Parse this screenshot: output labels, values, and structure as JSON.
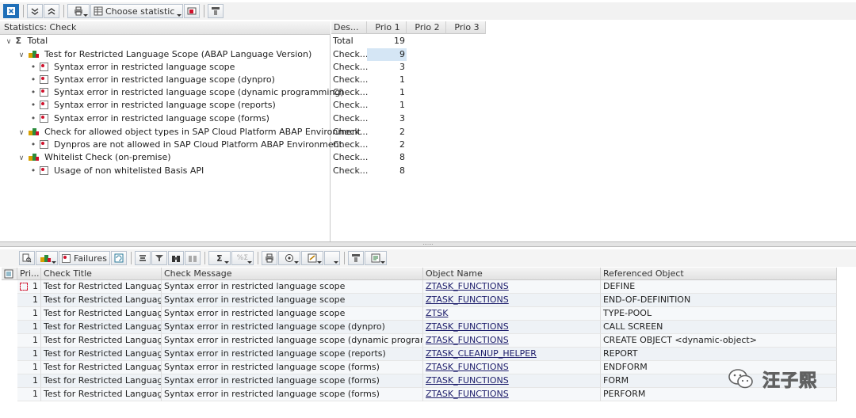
{
  "top_toolbar": {
    "choose_statistic_label": "Choose statistic"
  },
  "stats_panel": {
    "header": "Statistics: Check",
    "columns": [
      "Des...",
      "Prio 1",
      "Prio 2",
      "Prio 3"
    ],
    "rows": [
      {
        "label": "Total",
        "desc": "Total",
        "prio1": "19"
      },
      {
        "label": "Test for Restricted Language Scope (ABAP Language Version)",
        "desc": "Check...",
        "prio1": "9"
      },
      {
        "label": "Syntax error in restricted language scope",
        "desc": "Check...",
        "prio1": "3"
      },
      {
        "label": "Syntax error in restricted language scope (dynpro)",
        "desc": "Check...",
        "prio1": "1"
      },
      {
        "label": "Syntax error in restricted language scope (dynamic programming)",
        "desc": "Check...",
        "prio1": "1"
      },
      {
        "label": "Syntax error in restricted language scope (reports)",
        "desc": "Check...",
        "prio1": "1"
      },
      {
        "label": "Syntax error in restricted language scope (forms)",
        "desc": "Check...",
        "prio1": "3"
      },
      {
        "label": "Check for allowed object types in SAP Cloud Platform ABAP Environment",
        "desc": "Check...",
        "prio1": "2"
      },
      {
        "label": "Dynpros are not allowed in SAP Cloud Platform ABAP Environment",
        "desc": "Check...",
        "prio1": "2"
      },
      {
        "label": "Whitelist Check (on-premise)",
        "desc": "Check...",
        "prio1": "8"
      },
      {
        "label": "Usage of non whitelisted Basis API",
        "desc": "Check...",
        "prio1": "8"
      }
    ]
  },
  "splitter_grip": "......",
  "bottom_toolbar": {
    "failures_label": "Failures"
  },
  "results_grid": {
    "columns": [
      "Pri...",
      "Check Title",
      "Check Message",
      "Object Name",
      "Referenced Object"
    ],
    "rows": [
      {
        "prio": "1",
        "title": "Test for Restricted Languag...",
        "message": "Syntax error in restricted language scope",
        "object": "ZTASK_FUNCTIONS",
        "ref": "DEFINE"
      },
      {
        "prio": "1",
        "title": "Test for Restricted Languag...",
        "message": "Syntax error in restricted language scope",
        "object": "ZTASK_FUNCTIONS",
        "ref": "END-OF-DEFINITION"
      },
      {
        "prio": "1",
        "title": "Test for Restricted Languag...",
        "message": "Syntax error in restricted language scope",
        "object": "ZTSK",
        "ref": "TYPE-POOL"
      },
      {
        "prio": "1",
        "title": "Test for Restricted Languag...",
        "message": "Syntax error in restricted language scope (dynpro)",
        "object": "ZTASK_FUNCTIONS",
        "ref": "CALL SCREEN"
      },
      {
        "prio": "1",
        "title": "Test for Restricted Languag...",
        "message": "Syntax error in restricted language scope (dynamic programming)",
        "object": "ZTASK_FUNCTIONS",
        "ref": "CREATE OBJECT <dynamic-object>"
      },
      {
        "prio": "1",
        "title": "Test for Restricted Languag...",
        "message": "Syntax error in restricted language scope (reports)",
        "object": "ZTASK_CLEANUP_HELPER",
        "ref": "REPORT"
      },
      {
        "prio": "1",
        "title": "Test for Restricted Languag...",
        "message": "Syntax error in restricted language scope (forms)",
        "object": "ZTASK_FUNCTIONS",
        "ref": "ENDFORM"
      },
      {
        "prio": "1",
        "title": "Test for Restricted Languag...",
        "message": "Syntax error in restricted language scope (forms)",
        "object": "ZTASK_FUNCTIONS",
        "ref": "FORM"
      },
      {
        "prio": "1",
        "title": "Test for Restricted Languag...",
        "message": "Syntax error in restricted language scope (forms)",
        "object": "ZTASK_FUNCTIONS",
        "ref": "PERFORM"
      }
    ]
  },
  "watermark": {
    "name": "汪子熙"
  },
  "colors": {
    "selected_cell": "#d5e6f5",
    "link": "#1d1d6b",
    "error_red": "#d0102b",
    "toolbar_bg": "#f2f2f2"
  }
}
